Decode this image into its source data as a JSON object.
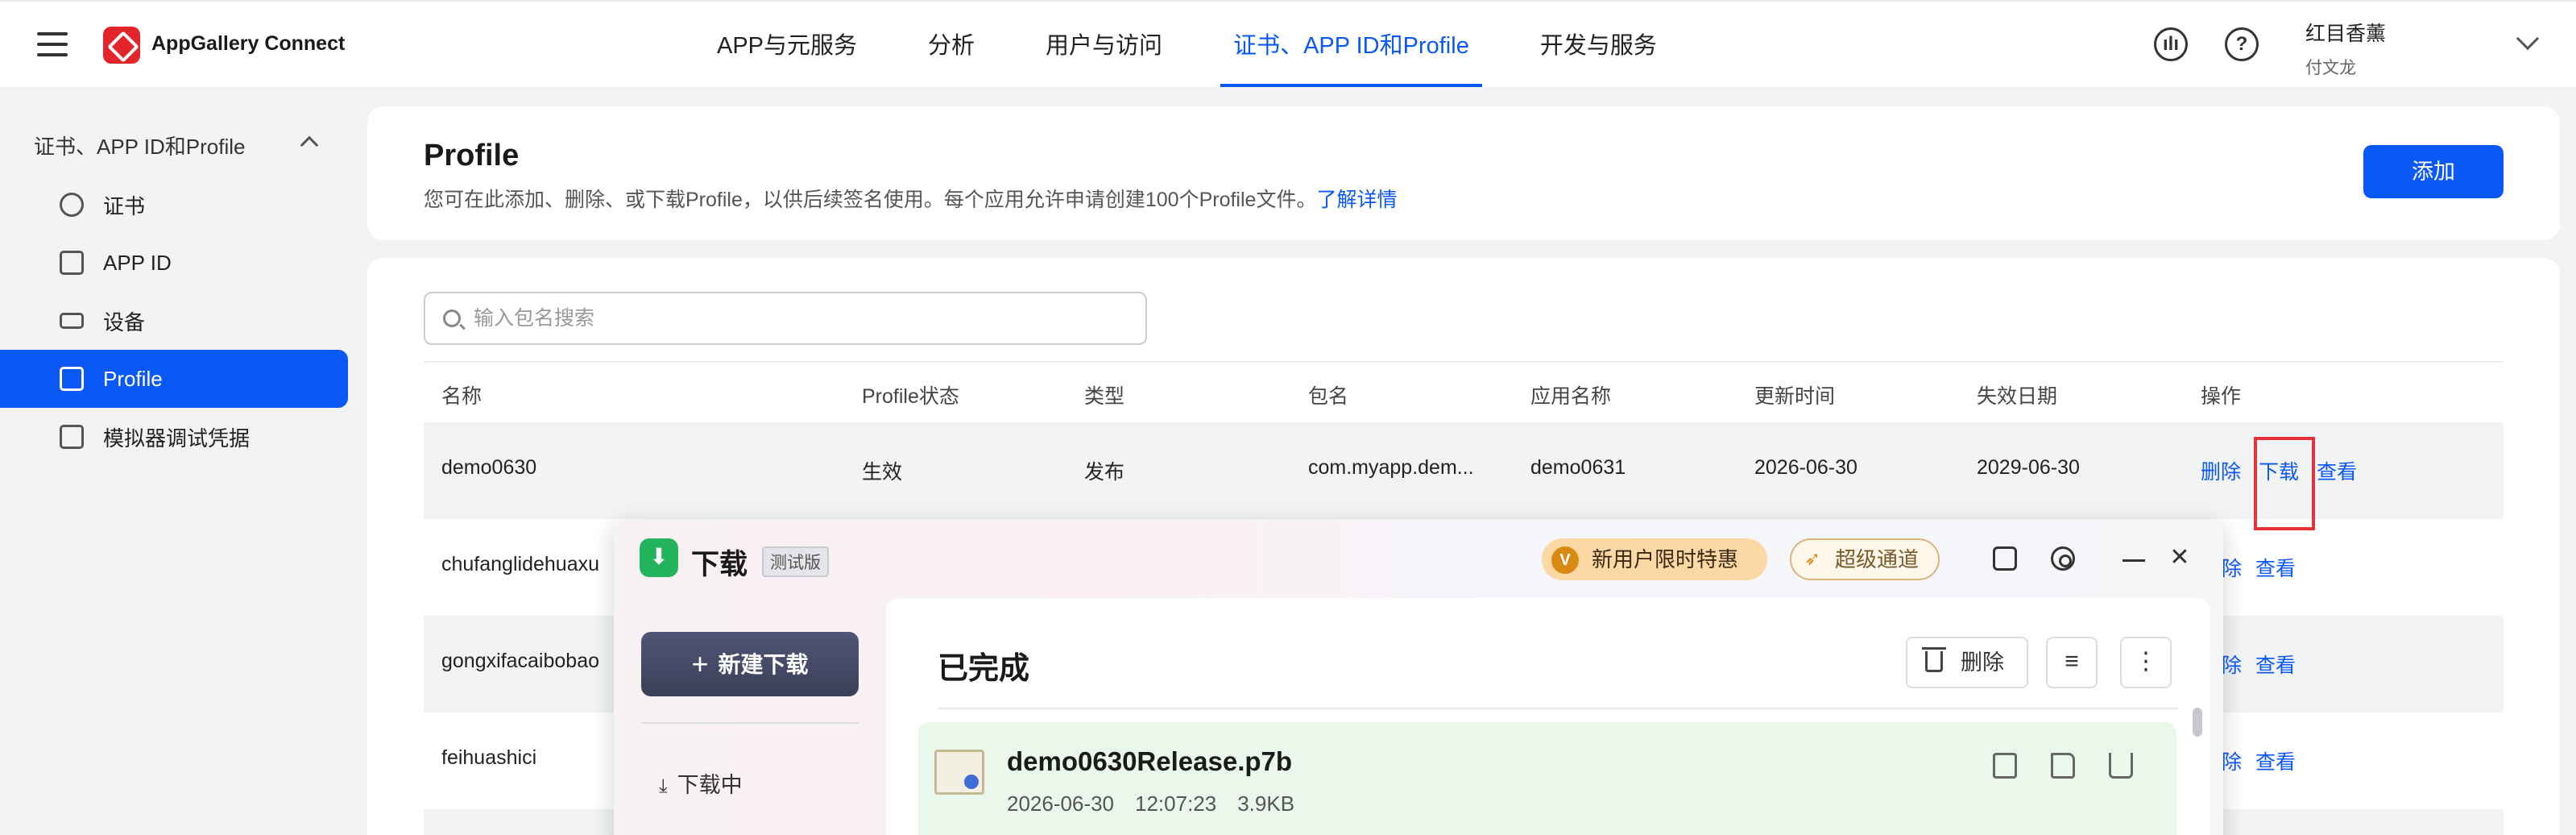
{
  "topbar": {
    "app_name": "AppGallery Connect",
    "nav": [
      "APP与元服务",
      "分析",
      "用户与访问",
      "证书、APP ID和Profile",
      "开发与服务"
    ],
    "active_nav_index": 3,
    "user_name": "红目香薰",
    "user_sub": "付文龙",
    "help_glyph": "?"
  },
  "sidebar": {
    "group_label": "证书、APP ID和Profile",
    "items": [
      {
        "label": "证书",
        "icon": "badge-icon"
      },
      {
        "label": "APP ID",
        "icon": "id-card-icon"
      },
      {
        "label": "设备",
        "icon": "device-icon"
      },
      {
        "label": "Profile",
        "icon": "profile-icon"
      },
      {
        "label": "模拟器调试凭据",
        "icon": "list-icon"
      }
    ],
    "active_index": 3
  },
  "header": {
    "title": "Profile",
    "description": "您可在此添加、删除、或下载Profile，以供后续签名使用。每个应用允许申请创建100个Profile文件。",
    "learn_more": "了解详情",
    "add_button": "添加"
  },
  "search": {
    "placeholder": "输入包名搜索"
  },
  "table": {
    "columns": [
      "名称",
      "Profile状态",
      "类型",
      "包名",
      "应用名称",
      "更新时间",
      "失效日期",
      "操作"
    ],
    "rows": [
      {
        "name": "demo0630",
        "status": "生效",
        "type": "发布",
        "package": "com.myapp.dem...",
        "app_name": "demo0631",
        "updated": "2026-06-30",
        "expires": "2029-06-30",
        "ops": [
          "删除",
          "下载",
          "查看"
        ]
      },
      {
        "name": "chufanglidehuaxu",
        "ops_visible": [
          "除",
          "查看"
        ]
      },
      {
        "name": "gongxifacaibobao",
        "ops_visible": [
          "除",
          "查看"
        ]
      },
      {
        "name": "feihuashici",
        "ops_visible": [
          "除",
          "查看"
        ]
      }
    ]
  },
  "download_window": {
    "title": "下载",
    "beta_tag": "测试版",
    "promo_new_user": "新用户限时特惠",
    "promo_vip_badge": "V",
    "promo_super": "超级通道",
    "new_download_button": "新建下载",
    "downloading_label": "下载中",
    "section_title": "已完成",
    "delete_button": "删除",
    "file": {
      "name": "demo0630Release.p7b",
      "date": "2026-06-30",
      "time": "12:07:23",
      "size": "3.9KB"
    }
  },
  "colors": {
    "accent": "#0a59f7",
    "highlight": "#e8323a",
    "completed_bg": "#e9f8ea",
    "promo_orange": "#fbd8a4"
  }
}
